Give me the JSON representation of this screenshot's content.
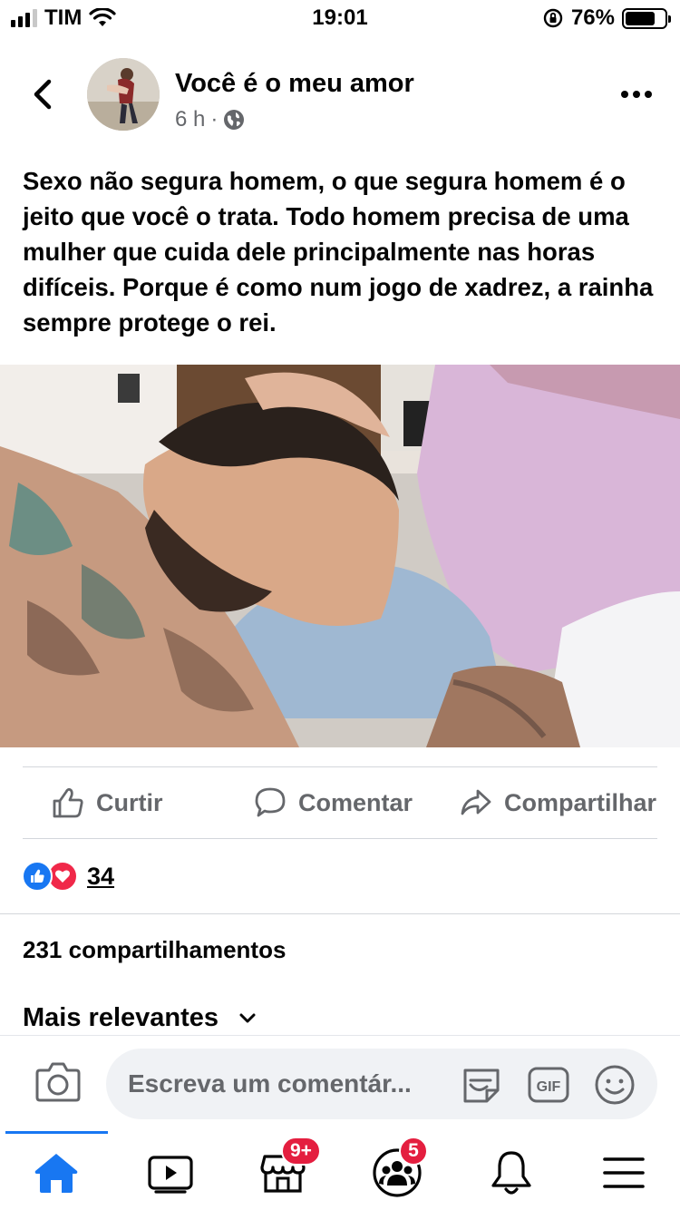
{
  "status_bar": {
    "carrier": "TIM",
    "time": "19:01",
    "battery_percent": "76%",
    "battery_level": 0.76,
    "signal_bars_on": 3,
    "signal_bars_total": 4
  },
  "post": {
    "title": "Você é o meu amor",
    "time_ago": "6 h",
    "meta_separator": "·",
    "text": "Sexo não segura homem, o que segura homem é o jeito que você o trata. Todo homem precisa de uma mulher que cuida dele principalmente nas horas difíceis. Porque é como num jogo de xadrez, a rainha sempre protege o rei."
  },
  "actions": {
    "like_label": "Curtir",
    "comment_label": "Comentar",
    "share_label": "Compartilhar"
  },
  "reactions": {
    "count": "34",
    "types": [
      "like",
      "love"
    ]
  },
  "shares_text": "231 compartilhamentos",
  "sort_label": "Mais relevantes",
  "composer": {
    "placeholder": "Escreva um comentár..."
  },
  "nav": {
    "marketplace_badge": "9+",
    "groups_badge": "5",
    "active": "home"
  },
  "colors": {
    "accent": "#1877f2",
    "badge": "#e41e3f",
    "secondary_text": "#65676b",
    "love": "#f02849"
  },
  "icons": [
    "back-icon",
    "globe-icon",
    "more-icon",
    "like-icon",
    "comment-icon",
    "share-icon",
    "camera-icon",
    "sticker-icon",
    "gif-icon",
    "emoji-icon",
    "home-icon",
    "watch-icon",
    "marketplace-icon",
    "groups-icon",
    "bell-icon",
    "menu-icon"
  ]
}
